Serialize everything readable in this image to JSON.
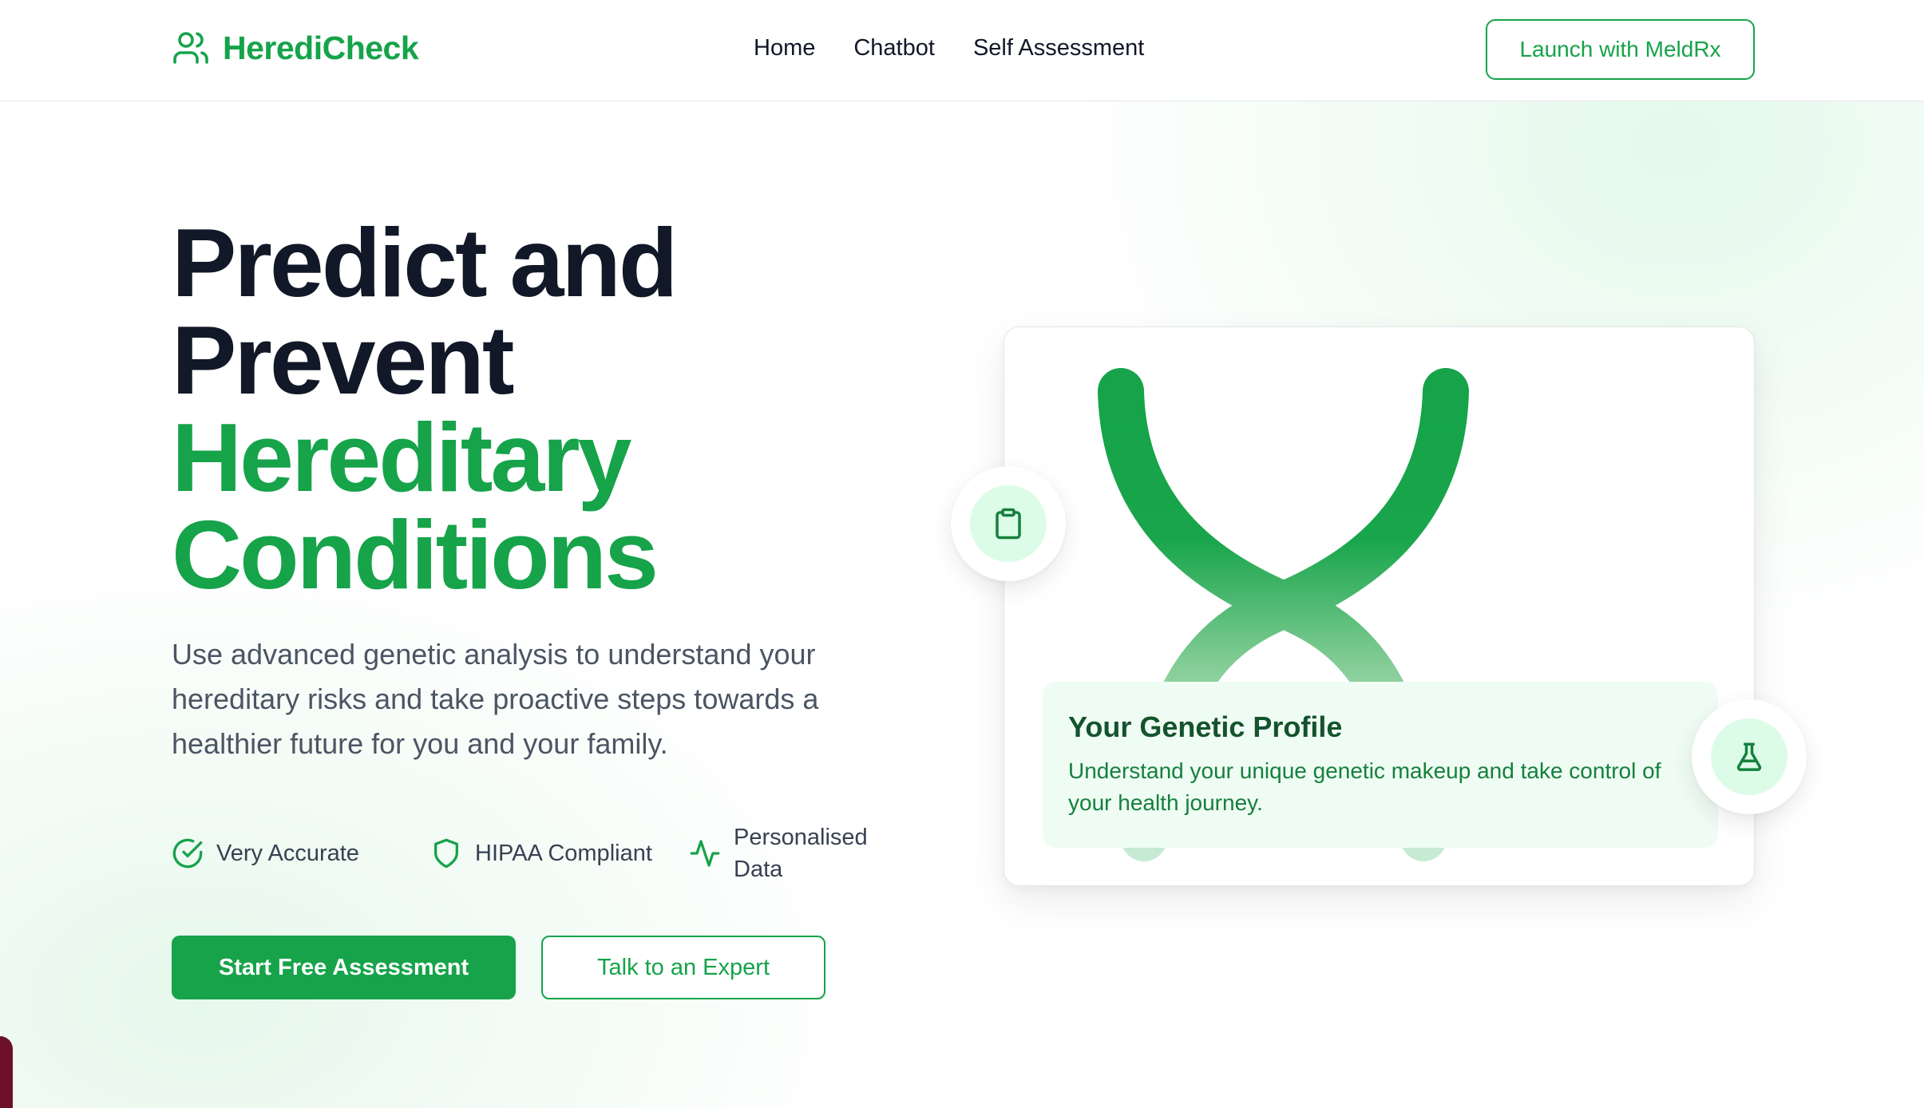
{
  "brand": {
    "name": "HerediCheck",
    "accent": "#16a34a",
    "text_dark": "#111827"
  },
  "nav": {
    "items": [
      {
        "label": "Home"
      },
      {
        "label": "Chatbot"
      },
      {
        "label": "Self Assessment"
      }
    ]
  },
  "header": {
    "cta_label": "Launch with MeldRx"
  },
  "hero": {
    "title_line1": "Predict and",
    "title_line2": "Prevent",
    "title_line3": "Hereditary",
    "title_line4": "Conditions",
    "description": "Use advanced genetic analysis to understand your hereditary risks and take proactive steps towards a healthier future for you and your family."
  },
  "features": [
    {
      "icon": "check-circle-icon",
      "label": "Very Accurate"
    },
    {
      "icon": "shield-icon",
      "label": "HIPAA Compliant"
    },
    {
      "icon": "activity-pulse-icon",
      "label": "Personalised Data"
    }
  ],
  "actions": {
    "primary_label": "Start Free Assessment",
    "secondary_label": "Talk to an Expert"
  },
  "profile_card": {
    "title": "Your Genetic Profile",
    "description": "Understand your unique genetic makeup and take control of your health journey.",
    "badge_left_icon": "clipboard-icon",
    "badge_right_icon": "flask-icon",
    "illustration": "dna-helix-icon"
  }
}
